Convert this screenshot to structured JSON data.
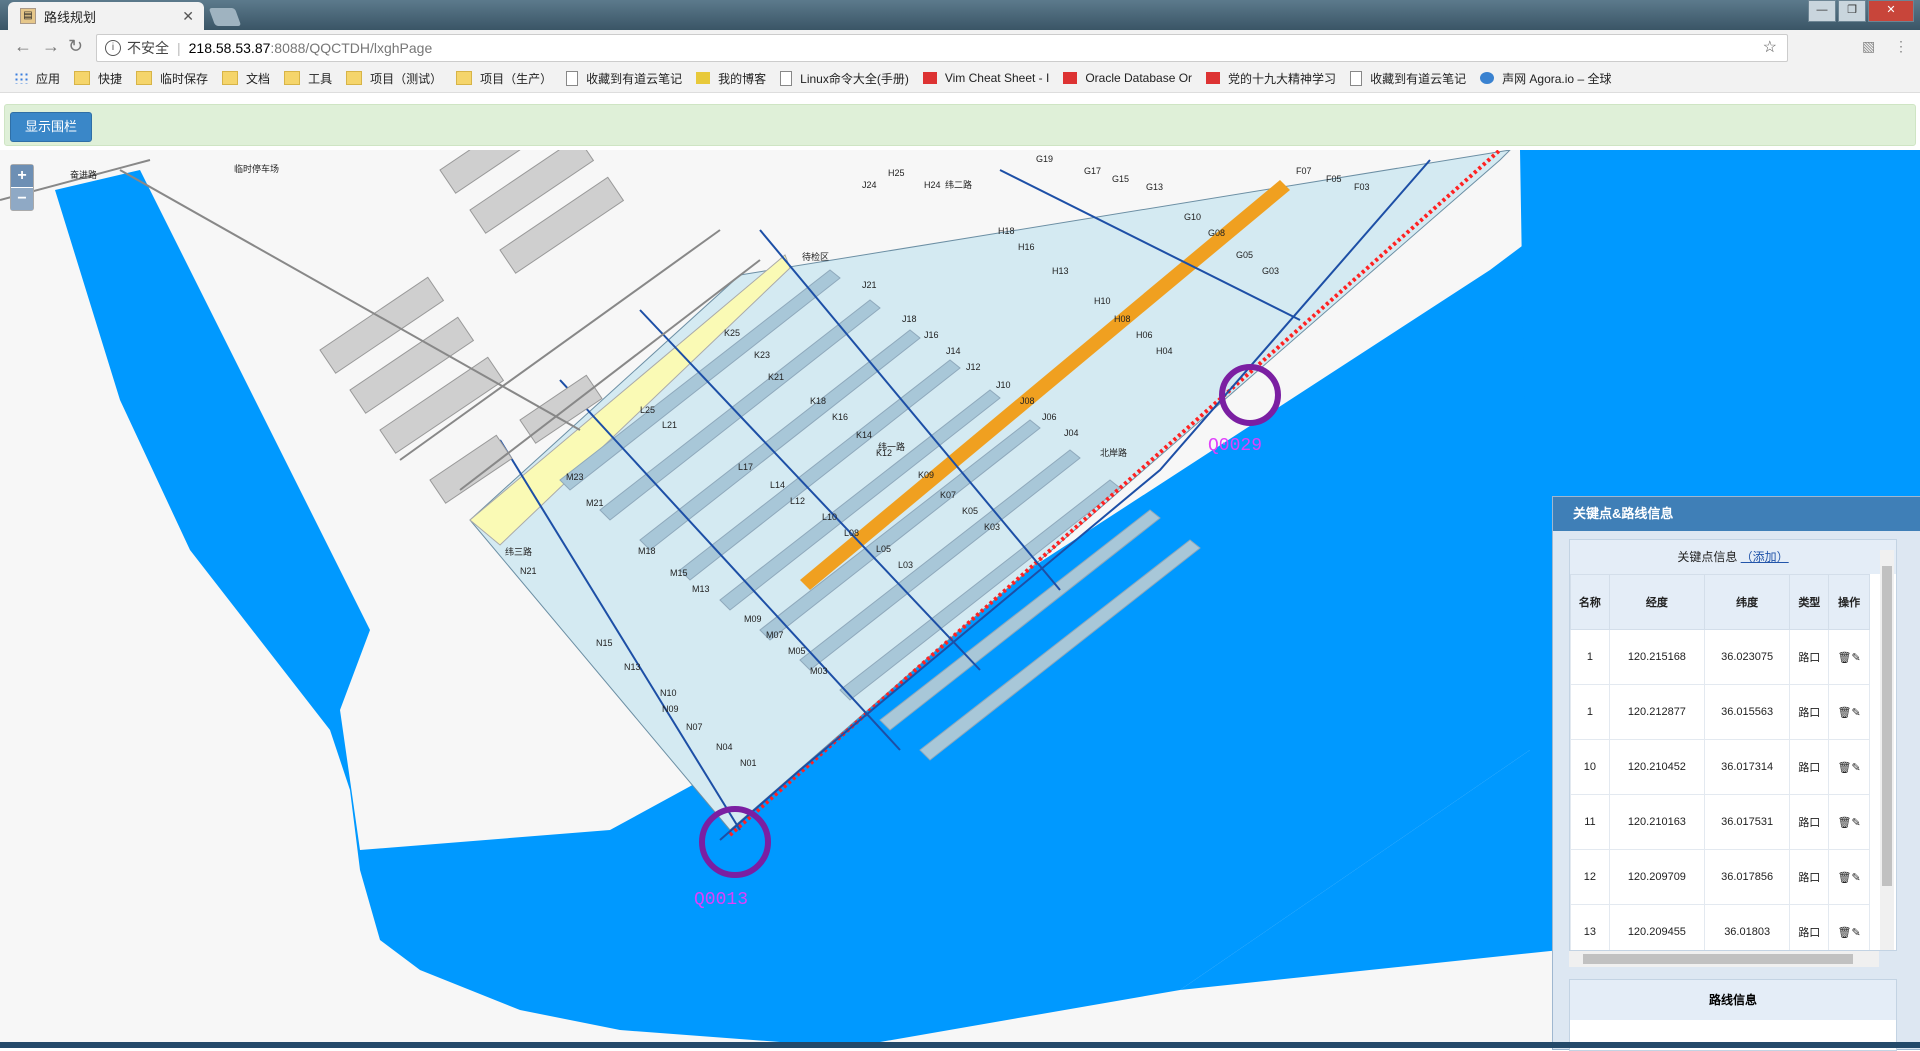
{
  "browser": {
    "tab_title": "路线规划",
    "url_insecure_label": "不安全",
    "url_host": "218.58.53.87",
    "url_path": ":8088/QQCTDH/lxghPage"
  },
  "bookmarks": [
    {
      "label": "应用",
      "icon": "apps-grid-icon"
    },
    {
      "label": "快捷",
      "icon": "folder-icon"
    },
    {
      "label": "临时保存",
      "icon": "folder-icon"
    },
    {
      "label": "文档",
      "icon": "folder-icon"
    },
    {
      "label": "工具",
      "icon": "folder-icon"
    },
    {
      "label": "项目（测试）",
      "icon": "folder-icon"
    },
    {
      "label": "项目（生产）",
      "icon": "folder-icon"
    },
    {
      "label": "收藏到有道云笔记",
      "icon": "page-icon"
    },
    {
      "label": "我的博客",
      "icon": "blog-icon"
    },
    {
      "label": "Linux命令大全(手册)",
      "icon": "linux-icon"
    },
    {
      "label": "Vim Cheat Sheet - I",
      "icon": "vim-icon"
    },
    {
      "label": "Oracle Database Or",
      "icon": "oracle-icon"
    },
    {
      "label": "党的十九大精神学习",
      "icon": "party-icon"
    },
    {
      "label": "收藏到有道云笔记",
      "icon": "page-icon"
    },
    {
      "label": "声网 Agora.io – 全球",
      "icon": "agora-icon"
    }
  ],
  "header": {
    "show_fence_button": "显示围栏"
  },
  "map": {
    "marker_a": "Q0029",
    "marker_b": "Q0013",
    "zoom_in": "+",
    "zoom_out": "−",
    "labels": [
      "临时停车场",
      "奋进路",
      "待检区",
      "北岸路",
      "纬二路",
      "纬三路",
      "纬一路",
      "K25",
      "K23",
      "K21",
      "K18",
      "K16",
      "K14",
      "K12",
      "K09",
      "K07",
      "K05",
      "K03",
      "L25",
      "L21",
      "L17",
      "L14",
      "L12",
      "L10",
      "L08",
      "L05",
      "L03",
      "M23",
      "M21",
      "M18",
      "M15",
      "M13",
      "M09",
      "M07",
      "M05",
      "M03",
      "N21",
      "N15",
      "N13",
      "N10",
      "N09",
      "N07",
      "N04",
      "N01",
      "J24",
      "J21",
      "J18",
      "J16",
      "J14",
      "J12",
      "J10",
      "J08",
      "J06",
      "J04",
      "H25",
      "H24",
      "H18",
      "H16",
      "H13",
      "H10",
      "H08",
      "H06",
      "H04",
      "G19",
      "G17",
      "G15",
      "G13",
      "G10",
      "G08",
      "G05",
      "G03",
      "F07",
      "F05",
      "F03"
    ]
  },
  "panel": {
    "title": "关键点&路线信息",
    "caption": "关键点信息",
    "add_link": "（添加）",
    "columns": [
      "名称",
      "经度",
      "纬度",
      "类型",
      "操作"
    ],
    "rows": [
      {
        "name": "1",
        "lng": "120.215168",
        "lat": "36.023075",
        "type": "路口"
      },
      {
        "name": "1",
        "lng": "120.212877",
        "lat": "36.015563",
        "type": "路口"
      },
      {
        "name": "10",
        "lng": "120.210452",
        "lat": "36.017314",
        "type": "路口"
      },
      {
        "name": "11",
        "lng": "120.210163",
        "lat": "36.017531",
        "type": "路口"
      },
      {
        "name": "12",
        "lng": "120.209709",
        "lat": "36.017856",
        "type": "路口"
      },
      {
        "name": "13",
        "lng": "120.209455",
        "lat": "36.01803",
        "type": "路口"
      }
    ],
    "route_title": "路线信息"
  }
}
